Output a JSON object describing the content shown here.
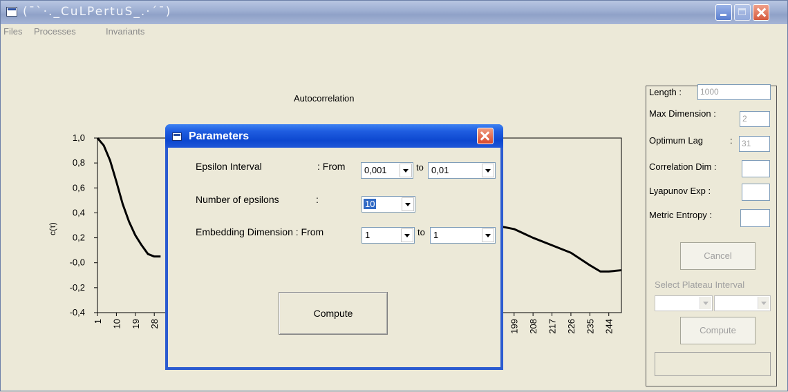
{
  "window": {
    "title": "(¯`·._CuLPertuS_.·´¯)"
  },
  "menu": {
    "items": [
      "Files",
      "Processes",
      "Invariants"
    ]
  },
  "chart_data": {
    "type": "line",
    "title": "Autocorrelation",
    "ylabel": "c(τ)",
    "ylim": [
      -0.4,
      1.0
    ],
    "yticks": [
      "1,0",
      "0,8",
      "0,6",
      "0,4",
      "0,2",
      "-0,0",
      "-0,2",
      "-0,4"
    ],
    "xticks_left": [
      "1",
      "10",
      "19",
      "28"
    ],
    "xticks_right": [
      "199",
      "208",
      "217",
      "226",
      "235",
      "244"
    ],
    "series": [
      {
        "x": [
          1,
          4,
          7,
          10,
          13,
          16,
          19,
          22,
          25,
          28,
          31
        ],
        "y": [
          1.0,
          0.94,
          0.82,
          0.65,
          0.47,
          0.33,
          0.22,
          0.14,
          0.07,
          0.05,
          0.05
        ]
      },
      {
        "x": [
          190,
          199,
          208,
          217,
          226,
          235,
          240,
          244,
          250
        ],
        "y": [
          0.3,
          0.27,
          0.2,
          0.14,
          0.08,
          -0.02,
          -0.07,
          -0.07,
          -0.06
        ]
      }
    ]
  },
  "side": {
    "length_label": "Length :",
    "length_value": "1000",
    "maxdim_label": "Max Dimension :",
    "maxdim_value": "2",
    "optlag_label": "Optimum Lag",
    "optlag_colon": ":",
    "optlag_value": "31",
    "corrdim_label": "Correlation Dim :",
    "lyap_label": "Lyapunov Exp :",
    "entropy_label": "Metric Entropy :",
    "cancel_label": "Cancel",
    "plateau_label": "Select Plateau Interval",
    "compute_label": "Compute"
  },
  "dialog": {
    "title": "Parameters",
    "epsilon_label": "Epsilon Interval",
    "epsilon_colon_from": ":   From",
    "epsilon_from": "0,001",
    "to_label": "to",
    "epsilon_to": "0,01",
    "num_label": "Number of epsilons",
    "num_colon": ":",
    "num_value": "10",
    "embed_label": "Embedding Dimension  :  From",
    "embed_from": "1",
    "embed_to": "1",
    "compute_label": "Compute"
  }
}
